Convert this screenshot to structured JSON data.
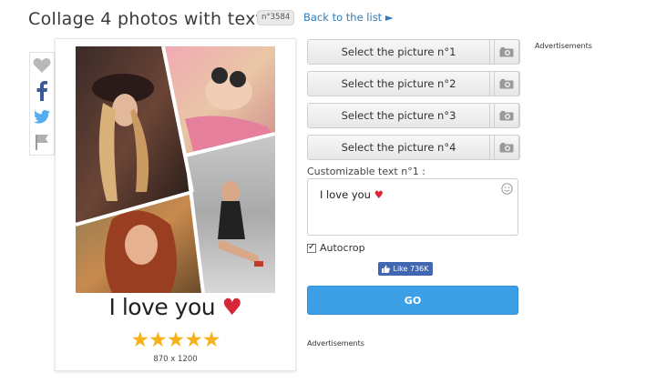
{
  "header": {
    "title": "Collage 4 photos with text",
    "badge": "n°3584",
    "back_link": "Back to the list ►"
  },
  "share": {
    "items": [
      "heart-icon",
      "facebook-icon",
      "twitter-icon",
      "flag-icon"
    ]
  },
  "preview": {
    "text": "I love you",
    "heart": "♥",
    "stars": "★★★★★",
    "rating": 4.5,
    "dimensions": "870 x 1200"
  },
  "pickers": [
    {
      "label": "Select the picture n°1"
    },
    {
      "label": "Select the picture n°2"
    },
    {
      "label": "Select the picture n°3"
    },
    {
      "label": "Select the picture n°4"
    }
  ],
  "custom_text": {
    "label": "Customizable text n°1 :",
    "value": "I love you",
    "heart": "♥"
  },
  "autocrop": {
    "label": "Autocrop",
    "checked": true
  },
  "facebook": {
    "like_label": "Like 736K"
  },
  "go": {
    "label": "GO"
  },
  "ads": {
    "top": "Advertisements",
    "bottom": "Advertisements"
  },
  "colors": {
    "accent": "#3d9fe6",
    "link": "#2d7bbd",
    "heart": "#d72638",
    "star": "#f5b21b",
    "facebook": "#4267b2"
  }
}
